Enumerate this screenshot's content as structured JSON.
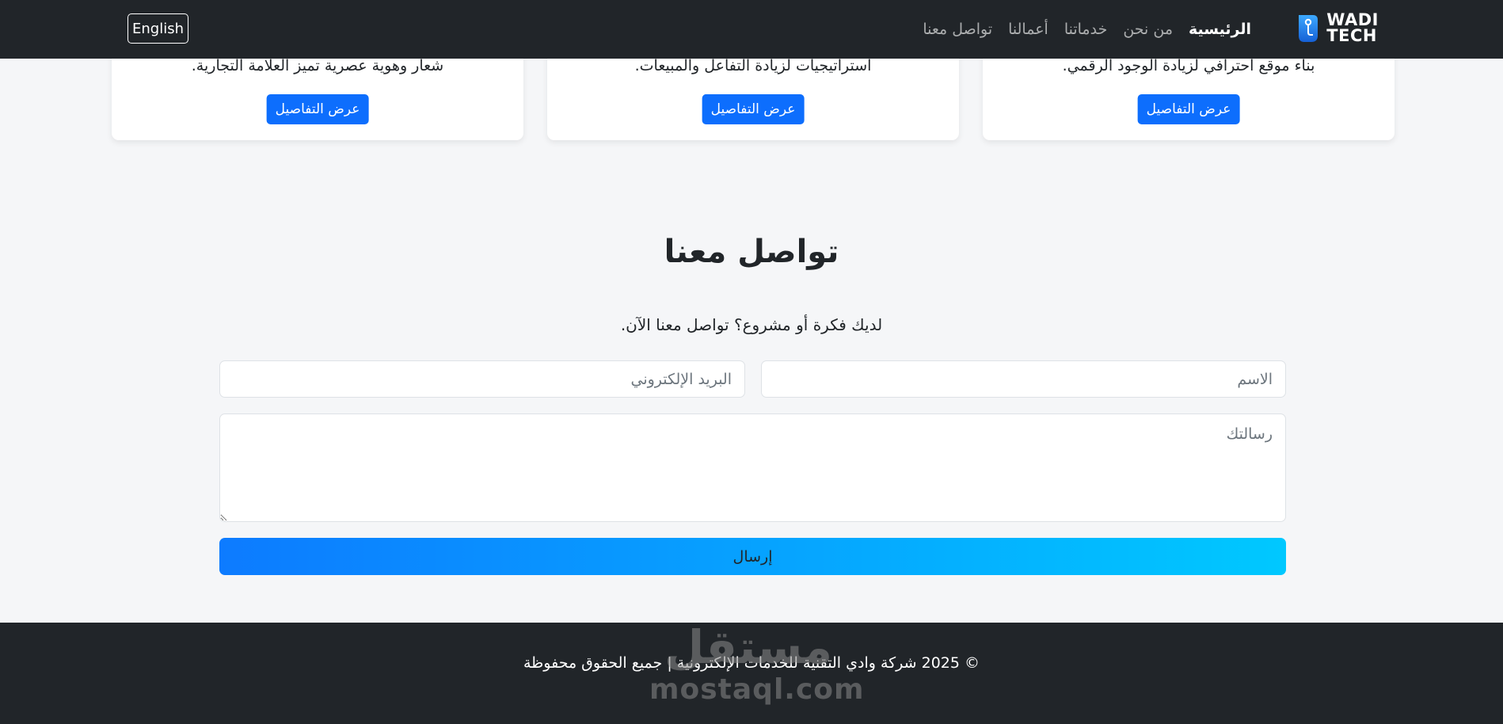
{
  "navbar": {
    "brand": {
      "line1": "WADI",
      "line2": "TECH"
    },
    "links": [
      {
        "label": "الرئيسية",
        "active": true
      },
      {
        "label": "من نحن",
        "active": false
      },
      {
        "label": "خدماتنا",
        "active": false
      },
      {
        "label": "أعمالنا",
        "active": false
      },
      {
        "label": "تواصل معنا",
        "active": false
      }
    ],
    "language_button": "English"
  },
  "services": {
    "cards": [
      {
        "description": "بناء موقع احترافي لزيادة الوجود الرقمي.",
        "button": "عرض التفاصيل"
      },
      {
        "description": "استراتيجيات لزيادة التفاعل والمبيعات.",
        "button": "عرض التفاصيل"
      },
      {
        "description": "شعار وهوية عصرية تميز العلامة التجارية.",
        "button": "عرض التفاصيل"
      }
    ]
  },
  "contact": {
    "title": "تواصل معنا",
    "subtitle": "لديك فكرة أو مشروع؟ تواصل معنا الآن.",
    "name_placeholder": "الاسم",
    "email_placeholder": "البريد الإلكتروني",
    "message_placeholder": "رسالتك",
    "submit_label": "إرسال"
  },
  "footer": {
    "copyright": "© 2025 شركة وادي التقنية للخدمات الإلكترونية | جميع الحقوق محفوظة"
  },
  "watermark": {
    "arabic": "مستقل",
    "latin": "mostaql.com"
  },
  "colors": {
    "navbar_bg": "#212529",
    "primary": "#0d6efd",
    "gradient_start": "#0d7bff",
    "gradient_end": "#00c8ff",
    "page_bg": "#f5f6f8"
  },
  "icons": {
    "brand": "circuit-pin-logo-icon"
  }
}
